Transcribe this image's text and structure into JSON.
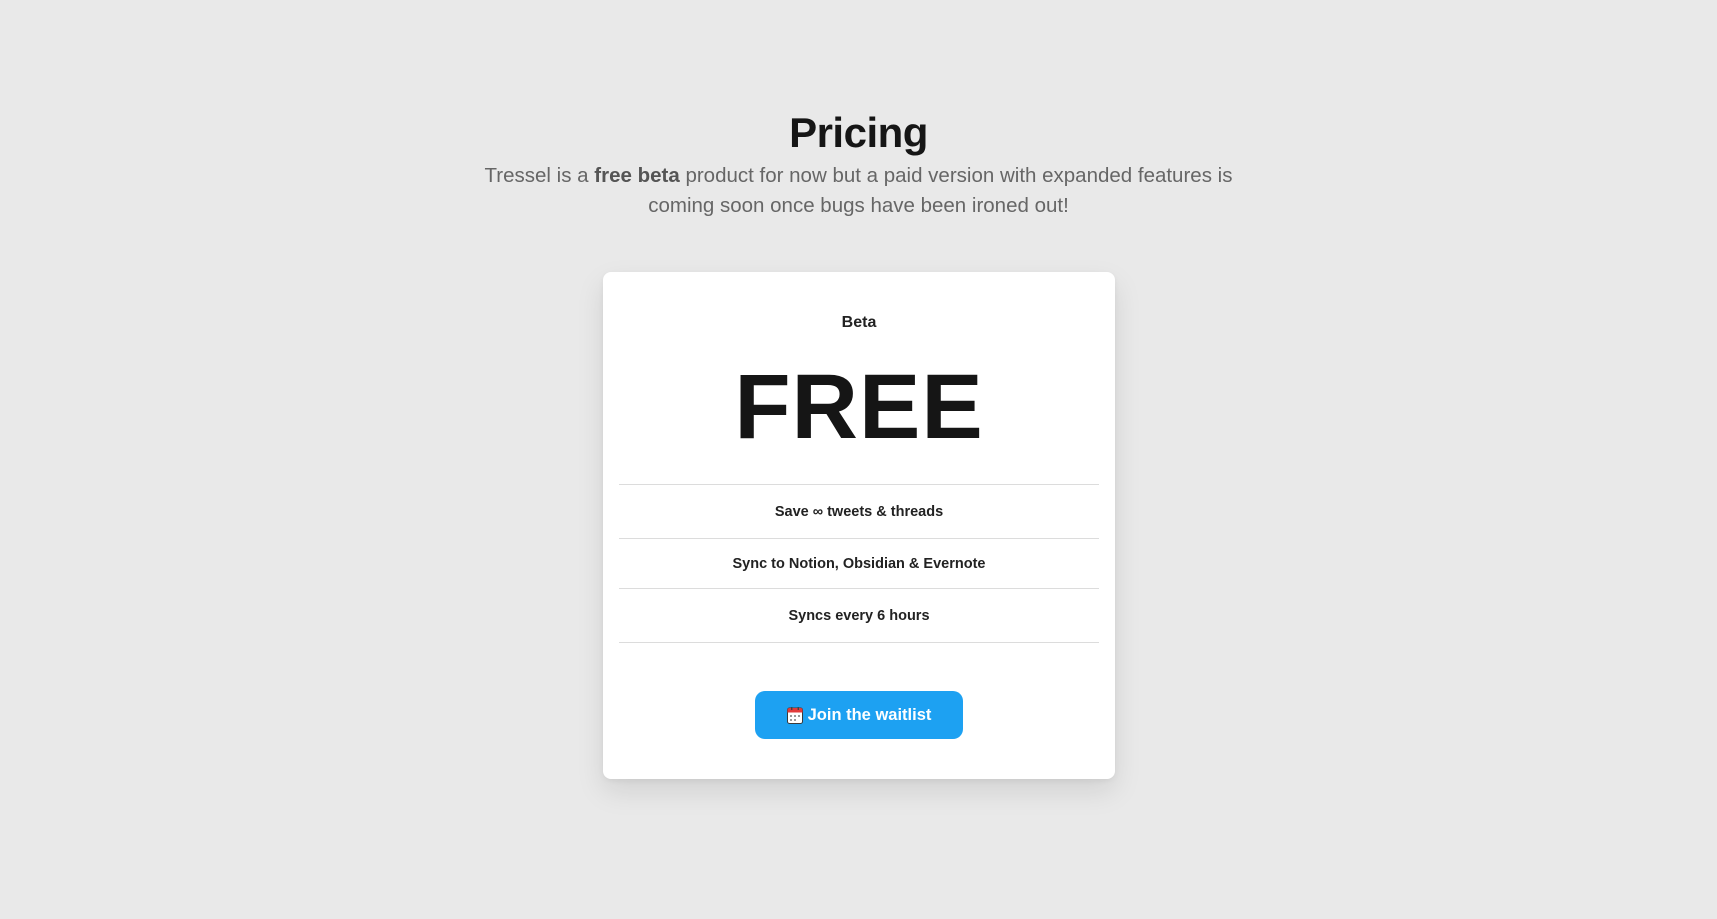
{
  "header": {
    "title": "Pricing",
    "subtitle_before": "Tressel is a ",
    "subtitle_bold": "free beta",
    "subtitle_after": " product for now but a paid version with expanded features is coming soon once bugs have been ironed out!"
  },
  "plan": {
    "name": "Beta",
    "price": "FREE",
    "features": [
      "Save ∞ tweets & threads",
      "Sync to Notion, Obsidian & Evernote",
      "Syncs every 6 hours"
    ],
    "cta_icon": "calendar-icon",
    "cta_label": "Join the waitlist"
  },
  "colors": {
    "background": "#e9e9e9",
    "card": "#ffffff",
    "accent": "#1da1f2",
    "text": "#1a1a1a",
    "muted": "#666666"
  }
}
